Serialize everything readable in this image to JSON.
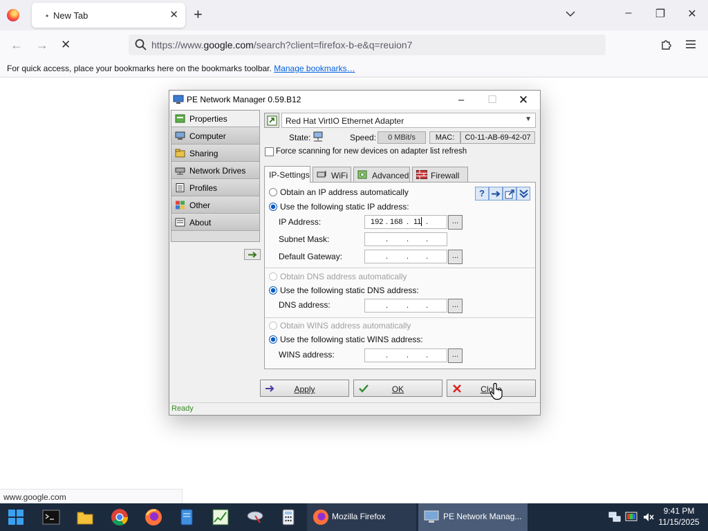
{
  "browser": {
    "tab_title": "New Tab",
    "url_prefix": "https://www.",
    "url_domain": "google.com",
    "url_rest": "/search?client=firefox-b-e&q=reuion7",
    "bookmarks_text": "For quick access, place your bookmarks here on the bookmarks toolbar.",
    "bookmarks_link": "Manage bookmarks…",
    "status_url": "www.google.com",
    "accent": "#0060df"
  },
  "pe": {
    "title": "PE Network Manager 0.59.B12",
    "sidebar": [
      {
        "label": "Properties",
        "icon": "properties-icon"
      },
      {
        "label": "Computer",
        "icon": "computer-icon"
      },
      {
        "label": "Sharing",
        "icon": "sharing-icon"
      },
      {
        "label": "Network Drives",
        "icon": "network-drives-icon"
      },
      {
        "label": "Profiles",
        "icon": "profiles-icon"
      },
      {
        "label": "Other",
        "icon": "other-icon"
      },
      {
        "label": "About",
        "icon": "about-icon"
      }
    ],
    "adapter": "Red Hat VirtIO Ethernet Adapter",
    "state_label": "State:",
    "speed_label": "Speed:",
    "speed_value": "0 MBit/s",
    "mac_label": "MAC:",
    "mac_value": "C0-11-AB-69-42-07",
    "force_scan": "Force scanning for new devices on adapter list refresh",
    "tabs": [
      "IP-Settings",
      "WiFi",
      "Advanced",
      "Firewall"
    ],
    "ip": {
      "auto_ip": "Obtain an IP address automatically",
      "static_ip": "Use the following static IP address:",
      "ip_label": "IP Address:",
      "ip_value": [
        "192",
        "168",
        "11",
        ""
      ],
      "mask_label": "Subnet Mask:",
      "gateway_label": "Default Gateway:",
      "auto_dns": "Obtain DNS address automatically",
      "static_dns": "Use the following static DNS address:",
      "dns_label": "DNS address:",
      "auto_wins": "Obtain WINS address automatically",
      "static_wins": "Use the following static WINS address:",
      "wins_label": "WINS address:",
      "dots": "...",
      "sep": "."
    },
    "buttons": {
      "apply": "Apply",
      "ok": "OK",
      "close": "Close"
    },
    "status": "Ready"
  },
  "taskbar": {
    "tasks": [
      "Mozilla Firefox",
      "PE Network Manag..."
    ],
    "time": "9:41 PM",
    "date": "11/15/2025"
  }
}
